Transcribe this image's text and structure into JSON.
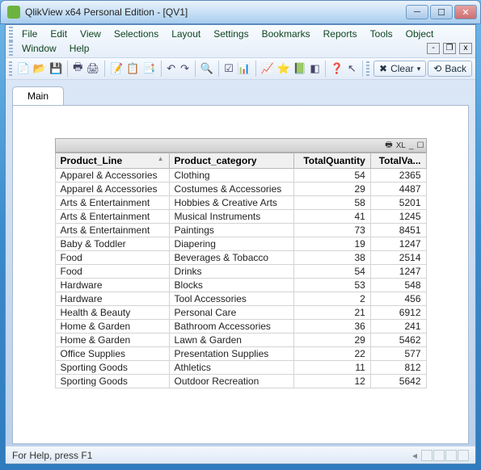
{
  "window": {
    "title": "QlikView x64 Personal Edition - [QV1]"
  },
  "menu": {
    "items": [
      "File",
      "Edit",
      "View",
      "Selections",
      "Layout",
      "Settings",
      "Bookmarks",
      "Reports",
      "Tools",
      "Object",
      "Window",
      "Help"
    ]
  },
  "toolbar": {
    "icons": [
      "new",
      "open",
      "save",
      "saveall",
      "print",
      "printpdf",
      "edit",
      "script",
      "reload",
      "undo",
      "redo",
      "search",
      "check",
      "conf",
      "chart",
      "bookmark",
      "wizard",
      "layout",
      "help",
      "select"
    ],
    "clear_label": "Clear",
    "back_label": "Back"
  },
  "tab": {
    "label": "Main"
  },
  "table": {
    "columns": [
      "Product_Line",
      "Product_category",
      "TotalQuantity",
      "TotalVa..."
    ],
    "rows": [
      {
        "pl": "Apparel & Accessories",
        "pc": "Clothing",
        "tq": 54,
        "tv": 2365
      },
      {
        "pl": "Apparel & Accessories",
        "pc": "Costumes & Accessories",
        "tq": 29,
        "tv": 4487
      },
      {
        "pl": "Arts & Entertainment",
        "pc": "Hobbies & Creative Arts",
        "tq": 58,
        "tv": 5201
      },
      {
        "pl": "Arts & Entertainment",
        "pc": "Musical Instruments",
        "tq": 41,
        "tv": 1245
      },
      {
        "pl": "Arts & Entertainment",
        "pc": "Paintings",
        "tq": 73,
        "tv": 8451
      },
      {
        "pl": "Baby & Toddler",
        "pc": "Diapering",
        "tq": 19,
        "tv": 1247
      },
      {
        "pl": "Food",
        "pc": "Beverages & Tobacco",
        "tq": 38,
        "tv": 2514
      },
      {
        "pl": "Food",
        "pc": "Drinks",
        "tq": 54,
        "tv": 1247
      },
      {
        "pl": "Hardware",
        "pc": "Blocks",
        "tq": 53,
        "tv": 548
      },
      {
        "pl": "Hardware",
        "pc": "Tool Accessories",
        "tq": 2,
        "tv": 456
      },
      {
        "pl": "Health & Beauty",
        "pc": "Personal Care",
        "tq": 21,
        "tv": 6912
      },
      {
        "pl": "Home & Garden",
        "pc": "Bathroom Accessories",
        "tq": 36,
        "tv": 241
      },
      {
        "pl": "Home & Garden",
        "pc": "Lawn & Garden",
        "tq": 29,
        "tv": 5462
      },
      {
        "pl": "Office Supplies",
        "pc": "Presentation Supplies",
        "tq": 22,
        "tv": 577
      },
      {
        "pl": "Sporting Goods",
        "pc": "Athletics",
        "tq": 11,
        "tv": 812
      },
      {
        "pl": "Sporting Goods",
        "pc": "Outdoor Recreation",
        "tq": 12,
        "tv": 5642
      }
    ]
  },
  "status": {
    "text": "For Help, press F1"
  },
  "chart_data": {
    "type": "table",
    "title": "",
    "columns": [
      "Product_Line",
      "Product_category",
      "TotalQuantity",
      "TotalValue"
    ],
    "series": [
      {
        "name": "TotalQuantity",
        "categories": [
          "Clothing",
          "Costumes & Accessories",
          "Hobbies & Creative Arts",
          "Musical Instruments",
          "Paintings",
          "Diapering",
          "Beverages & Tobacco",
          "Drinks",
          "Blocks",
          "Tool Accessories",
          "Personal Care",
          "Bathroom Accessories",
          "Lawn & Garden",
          "Presentation Supplies",
          "Athletics",
          "Outdoor Recreation"
        ],
        "values": [
          54,
          29,
          58,
          41,
          73,
          19,
          38,
          54,
          53,
          2,
          21,
          36,
          29,
          22,
          11,
          12
        ]
      },
      {
        "name": "TotalValue",
        "categories": [
          "Clothing",
          "Costumes & Accessories",
          "Hobbies & Creative Arts",
          "Musical Instruments",
          "Paintings",
          "Diapering",
          "Beverages & Tobacco",
          "Drinks",
          "Blocks",
          "Tool Accessories",
          "Personal Care",
          "Bathroom Accessories",
          "Lawn & Garden",
          "Presentation Supplies",
          "Athletics",
          "Outdoor Recreation"
        ],
        "values": [
          2365,
          4487,
          5201,
          1245,
          8451,
          1247,
          2514,
          1247,
          548,
          456,
          6912,
          241,
          5462,
          577,
          812,
          5642
        ]
      }
    ]
  }
}
